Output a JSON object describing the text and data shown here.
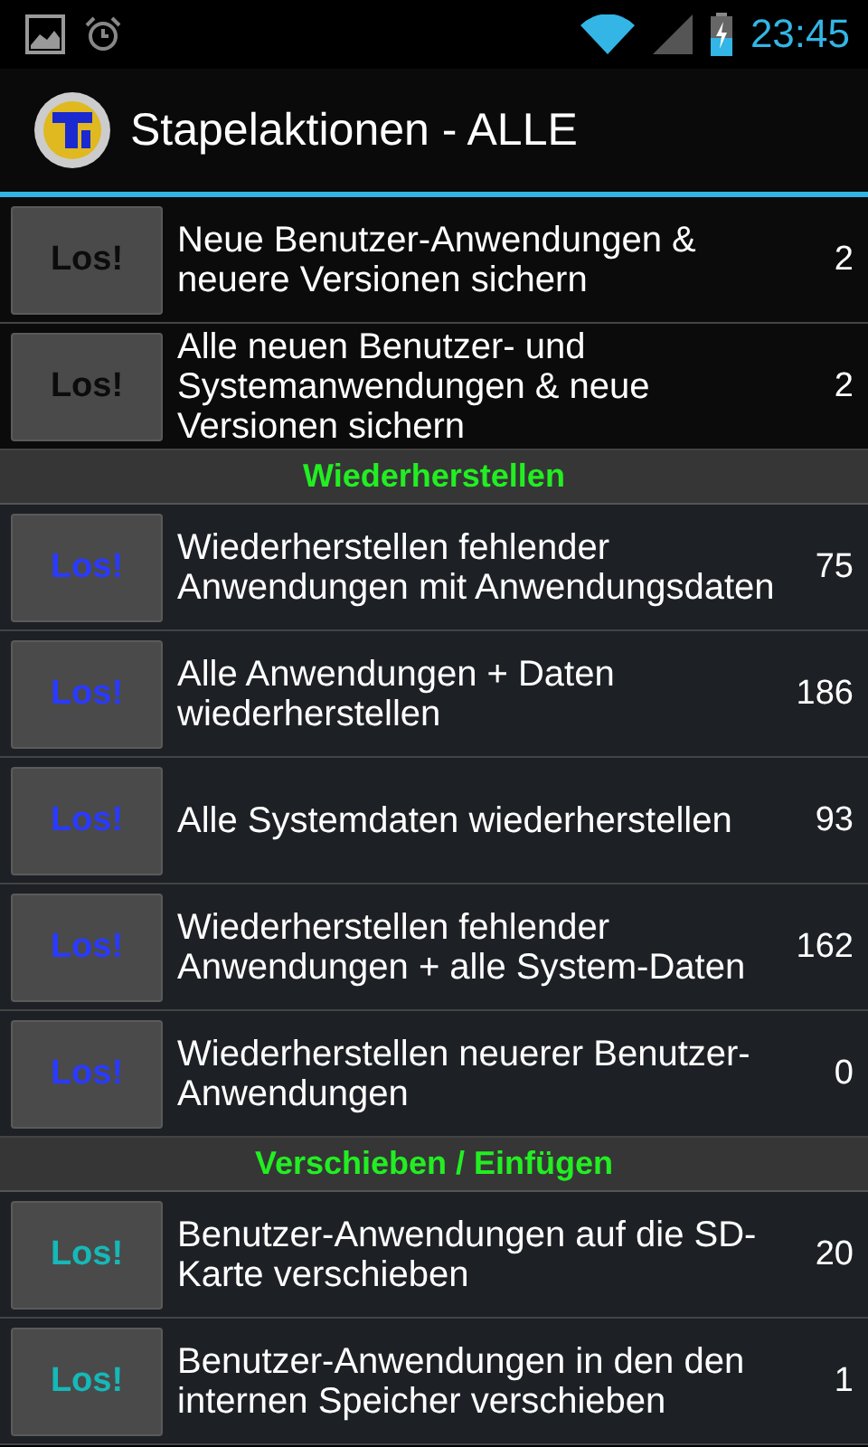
{
  "status_bar": {
    "time": "23:45"
  },
  "app_bar": {
    "title": "Stapelaktionen - ALLE"
  },
  "sections": [
    {
      "actions": [
        {
          "button": "Los!",
          "kind": "backup",
          "label": "Neue Benutzer-Anwendungen & neuere Versionen sichern",
          "count": "2"
        },
        {
          "button": "Los!",
          "kind": "backup",
          "label": "Alle neuen Benutzer- und Systemanwendungen & neue Versionen sichern",
          "count": "2"
        }
      ]
    },
    {
      "heading": "Wiederherstellen",
      "actions": [
        {
          "button": "Los!",
          "kind": "restore",
          "label": "Wiederherstellen fehlender Anwendungen mit Anwendungsdaten",
          "count": "75"
        },
        {
          "button": "Los!",
          "kind": "restore",
          "label": "Alle Anwendungen + Daten wiederherstellen",
          "count": "186"
        },
        {
          "button": "Los!",
          "kind": "restore",
          "label": "Alle Systemdaten wiederherstellen",
          "count": "93"
        },
        {
          "button": "Los!",
          "kind": "restore",
          "label": "Wiederherstellen fehlender Anwendungen + alle System-Daten",
          "count": "162"
        },
        {
          "button": "Los!",
          "kind": "restore",
          "label": "Wiederherstellen neuerer Benutzer-Anwendungen",
          "count": "0"
        }
      ]
    },
    {
      "heading": "Verschieben / Einfügen",
      "actions": [
        {
          "button": "Los!",
          "kind": "move",
          "label": "Benutzer-Anwendungen auf die SD-Karte verschieben",
          "count": "20"
        },
        {
          "button": "Los!",
          "kind": "move",
          "label": "Benutzer-Anwendungen in den den internen Speicher verschieben",
          "count": "1"
        }
      ]
    }
  ]
}
